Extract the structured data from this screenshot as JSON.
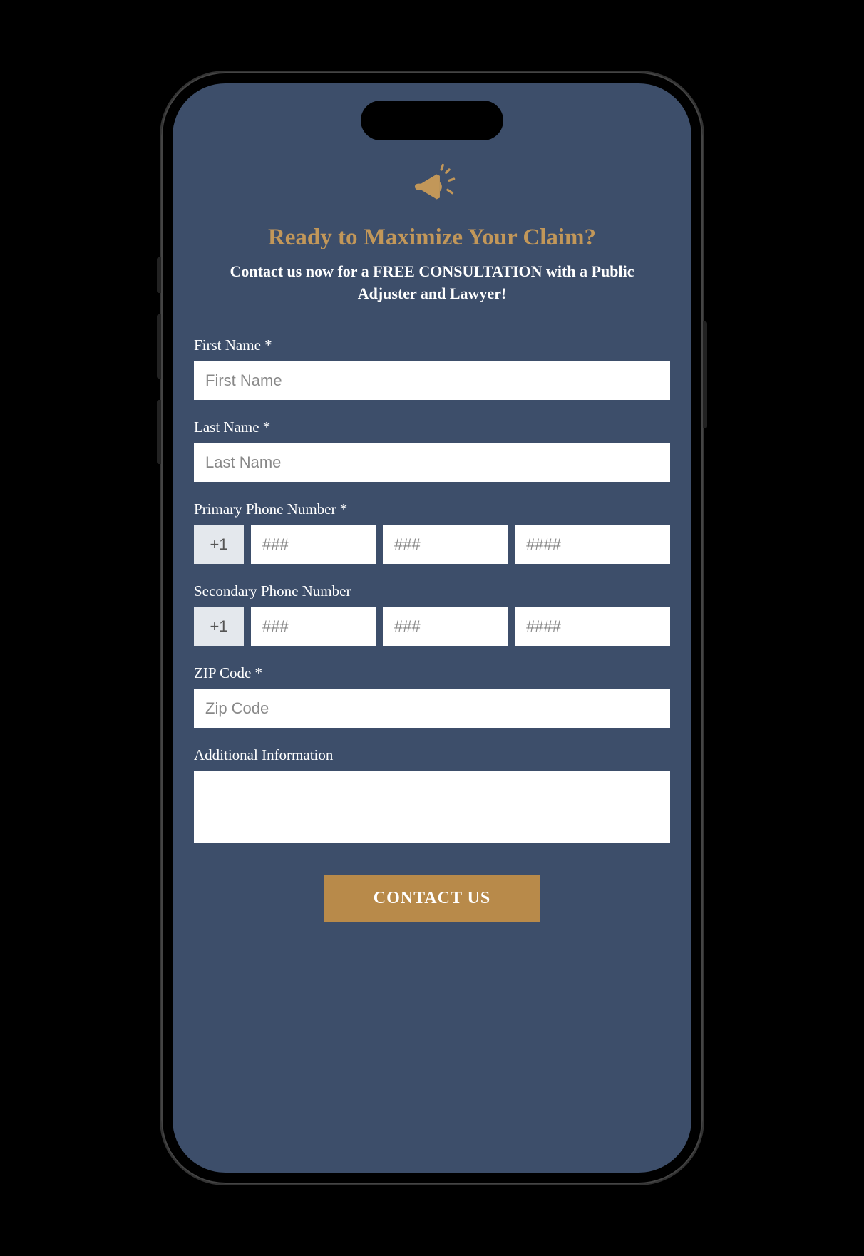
{
  "header": {
    "icon": "megaphone-icon",
    "headline": "Ready to Maximize Your Claim?",
    "subheadline": "Contact us now for a FREE CONSULTATION with a Public Adjuster and Lawyer!"
  },
  "form": {
    "firstName": {
      "label": "First Name *",
      "placeholder": "First Name",
      "value": ""
    },
    "lastName": {
      "label": "Last Name *",
      "placeholder": "Last Name",
      "value": ""
    },
    "primaryPhone": {
      "label": "Primary Phone Number *",
      "prefix": "+1",
      "placeholder1": "###",
      "placeholder2": "###",
      "placeholder3": "####"
    },
    "secondaryPhone": {
      "label": "Secondary Phone Number",
      "prefix": "+1",
      "placeholder1": "###",
      "placeholder2": "###",
      "placeholder3": "####"
    },
    "zipCode": {
      "label": "ZIP Code *",
      "placeholder": "Zip Code",
      "value": ""
    },
    "additionalInfo": {
      "label": "Additional Information",
      "value": ""
    },
    "submitLabel": "CONTACT US"
  },
  "colors": {
    "background": "#3d4e6a",
    "accent": "#c29759",
    "button": "#b88a4a"
  }
}
